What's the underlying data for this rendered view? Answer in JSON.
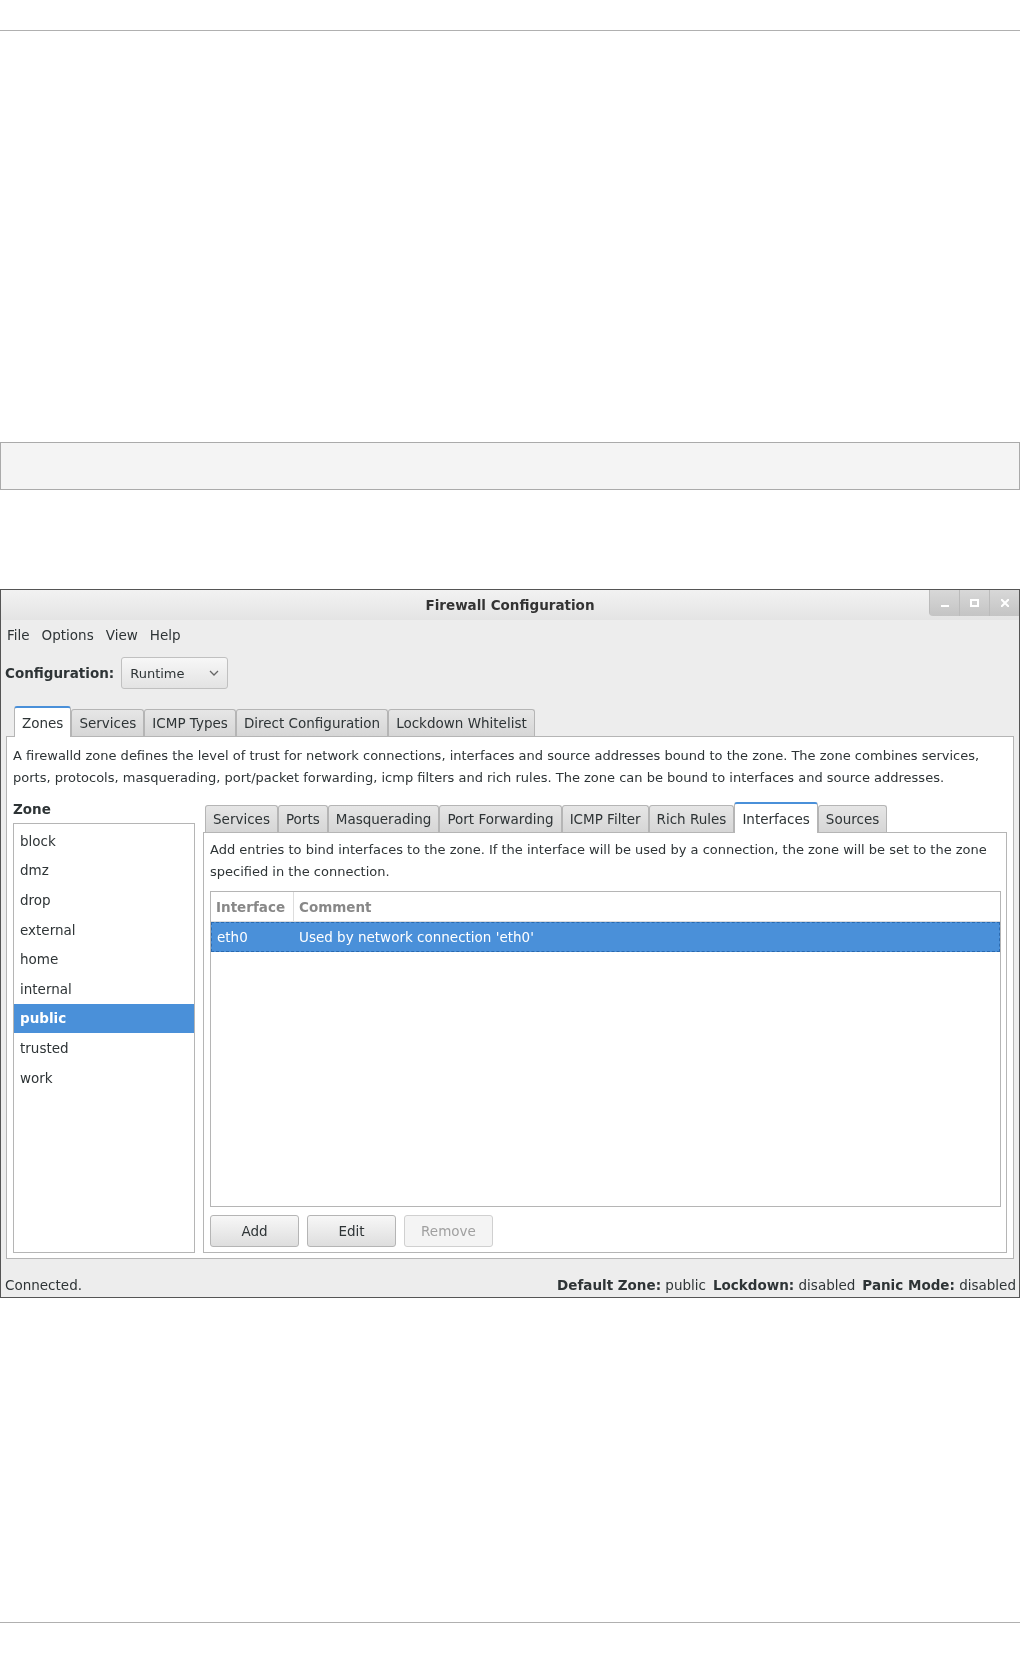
{
  "window": {
    "title": "Firewall Configuration"
  },
  "menu": [
    "File",
    "Options",
    "View",
    "Help"
  ],
  "configuration": {
    "label": "Configuration:",
    "value": "Runtime"
  },
  "tabs": [
    {
      "label": "Zones",
      "selected": true
    },
    {
      "label": "Services",
      "selected": false
    },
    {
      "label": "ICMP Types",
      "selected": false
    },
    {
      "label": "Direct Configuration",
      "selected": false
    },
    {
      "label": "Lockdown Whitelist",
      "selected": false
    }
  ],
  "description": "A firewalld zone defines the level of trust for network connections, interfaces and source addresses bound to the zone. The zone combines services, ports, protocols, masquerading, port/packet forwarding, icmp filters and rich rules. The zone can be bound to interfaces and source addresses.",
  "zone_list": {
    "heading": "Zone",
    "items": [
      {
        "label": "block",
        "selected": false
      },
      {
        "label": "dmz",
        "selected": false
      },
      {
        "label": "drop",
        "selected": false
      },
      {
        "label": "external",
        "selected": false
      },
      {
        "label": "home",
        "selected": false
      },
      {
        "label": "internal",
        "selected": false
      },
      {
        "label": "public",
        "selected": true
      },
      {
        "label": "trusted",
        "selected": false
      },
      {
        "label": "work",
        "selected": false
      }
    ]
  },
  "zone_tabs": [
    {
      "label": "Services",
      "selected": false
    },
    {
      "label": "Ports",
      "selected": false
    },
    {
      "label": "Masquerading",
      "selected": false
    },
    {
      "label": "Port Forwarding",
      "selected": false
    },
    {
      "label": "ICMP Filter",
      "selected": false
    },
    {
      "label": "Rich Rules",
      "selected": false
    },
    {
      "label": "Interfaces",
      "selected": true
    },
    {
      "label": "Sources",
      "selected": false
    }
  ],
  "zone_tab_description": "Add entries to bind interfaces to the zone. If the interface will be used by a connection, the zone will be set to the zone specified in the connection.",
  "interfaces_table": {
    "columns": [
      "Interface",
      "Comment"
    ],
    "rows": [
      {
        "cells": [
          "eth0",
          "Used by network connection 'eth0'"
        ],
        "selected": true
      }
    ]
  },
  "buttons": [
    {
      "label": "Add",
      "disabled": false
    },
    {
      "label": "Edit",
      "disabled": false
    },
    {
      "label": "Remove",
      "disabled": true
    }
  ],
  "status_bar": {
    "message": "Connected.",
    "fields": [
      {
        "label": "Default Zone:",
        "value": "public"
      },
      {
        "label": "Lockdown:",
        "value": "disabled"
      },
      {
        "label": "Panic Mode:",
        "value": "disabled"
      }
    ]
  }
}
